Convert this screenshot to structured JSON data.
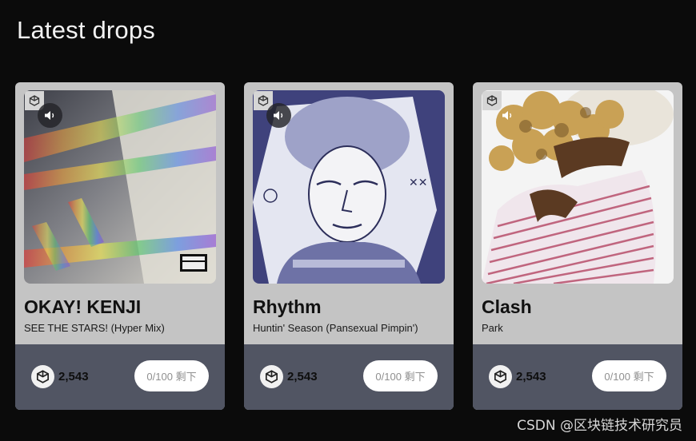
{
  "section": {
    "title": "Latest drops"
  },
  "cards": [
    {
      "title": "OKAY! KENJI",
      "subtitle": "SEE THE STARS! (Hyper Mix)",
      "price": "2,543",
      "remaining": "0/100 剩下",
      "art": "rainbow-prism-art",
      "parental_label": "PARENTAL ADVISORY"
    },
    {
      "title": "Rhythm",
      "subtitle": "Huntin' Season (Pansexual Pimpin')",
      "price": "2,543",
      "remaining": "0/100 剩下",
      "art": "sketch-portrait-art"
    },
    {
      "title": "Clash",
      "subtitle": "Park",
      "price": "2,543",
      "remaining": "0/100 剩下",
      "art": "curly-hair-photo-art"
    }
  ],
  "icons": {
    "badge": "cube-icon",
    "sound": "speaker-icon",
    "coin": "cube-coin-icon"
  },
  "colors": {
    "background": "#0b0b0b",
    "card": "#c4c4c4",
    "footer": "#515563"
  },
  "watermark": "CSDN @区块链技术研究员"
}
